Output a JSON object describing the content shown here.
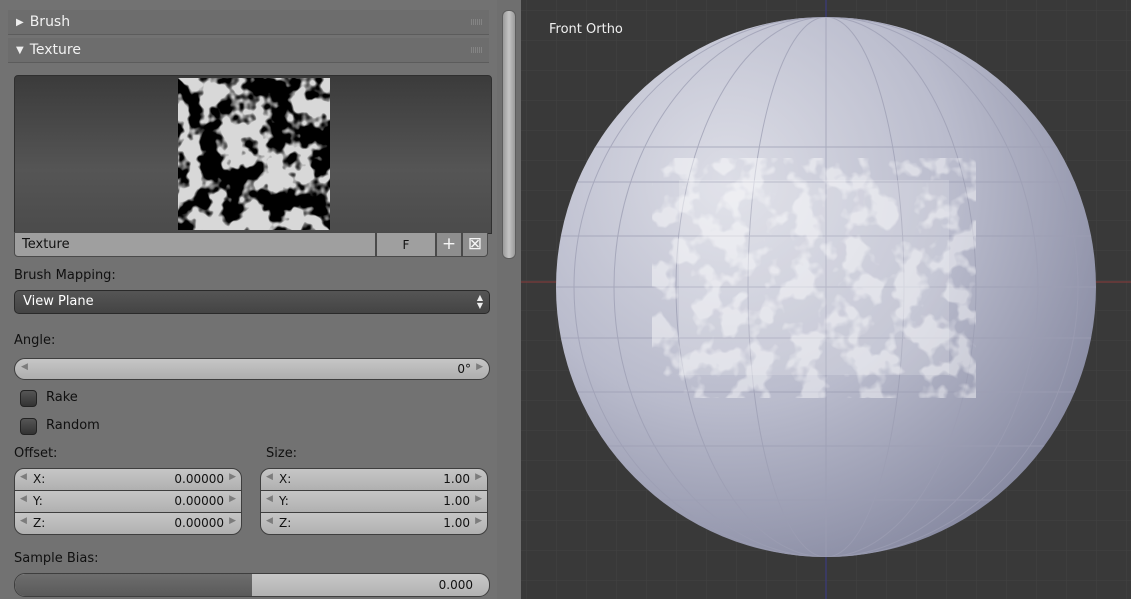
{
  "panel": {
    "brush_header": "Brush",
    "texture_header": "Texture",
    "texture_slot": {
      "name": "Texture",
      "fake_user": "F",
      "add_icon": "plus-icon",
      "remove_icon": "x-icon"
    },
    "brush_mapping_label": "Brush Mapping:",
    "brush_mapping_value": "View Plane",
    "angle_label": "Angle:",
    "angle_value": "0°",
    "rake_label": "Rake",
    "random_label": "Random",
    "offset_label": "Offset:",
    "size_label": "Size:",
    "offset": [
      {
        "axis": "X:",
        "value": "0.00000"
      },
      {
        "axis": "Y:",
        "value": "0.00000"
      },
      {
        "axis": "Z:",
        "value": "0.00000"
      }
    ],
    "size": [
      {
        "axis": "X:",
        "value": "1.00"
      },
      {
        "axis": "Y:",
        "value": "1.00"
      },
      {
        "axis": "Z:",
        "value": "1.00"
      }
    ],
    "sample_bias_label": "Sample Bias:",
    "sample_bias_value": "0.000",
    "sample_bias_fill": 0.5
  },
  "viewport": {
    "view_label": "Front Ortho",
    "background_color": "#393939",
    "sphere_color": "#b8bacb"
  }
}
